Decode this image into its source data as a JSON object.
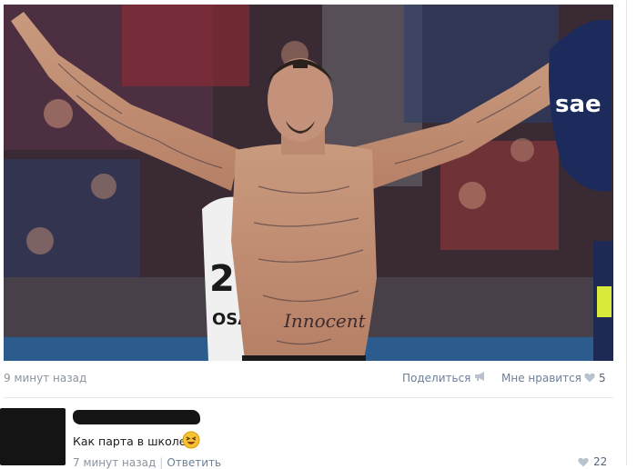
{
  "post": {
    "photo_alt": "Shirtless tattooed footballer with arms raised in front of a crowd",
    "photo_jersey_number": "25",
    "photo_shirt_text": "OSA",
    "photo_belly_tattoo": "Innocent",
    "photo_sponsor": "sae",
    "time": "9 минут назад",
    "share_label": "Поделиться",
    "like_label": "Мне нравится",
    "like_count": "5"
  },
  "comment": {
    "text": "Как парта в школе",
    "time": "7 минут назад",
    "reply_label": "Ответить",
    "like_count": "22"
  },
  "icons": {
    "share": "megaphone-icon",
    "like": "heart-icon",
    "emoji": "laughing-emoji"
  },
  "colors": {
    "link": "#6b7f99",
    "meta": "#8a939f",
    "heart": "#b9c3cf"
  }
}
